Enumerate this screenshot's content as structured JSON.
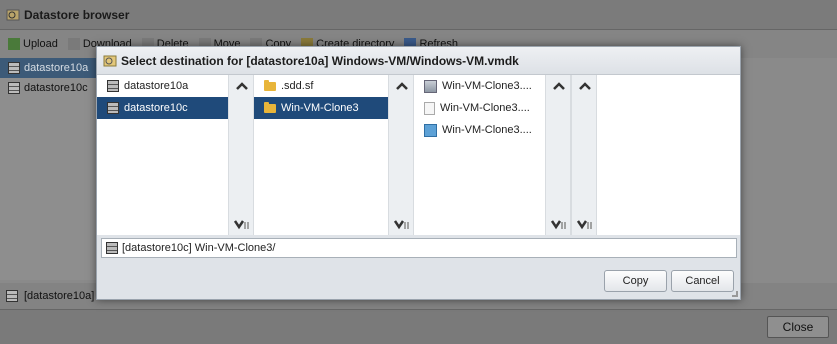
{
  "background": {
    "window_title": "Datastore browser",
    "toolbar": [
      "Upload",
      "Download",
      "Delete",
      "Move",
      "Copy",
      "Create directory",
      "Refresh"
    ],
    "datastores": [
      "datastore10a",
      "datastore10c"
    ],
    "status_path": "[datastore10a]",
    "close_label": "Close"
  },
  "dialog": {
    "title": "Select destination for [datastore10a] Windows-VM/Windows-VM.vmdk",
    "col1": [
      {
        "label": "datastore10a",
        "icon": "datastore-icon",
        "selected": false
      },
      {
        "label": "datastore10c",
        "icon": "datastore-icon",
        "selected": true
      }
    ],
    "col2": [
      {
        "label": ".sdd.sf",
        "icon": "folder-icon",
        "selected": false
      },
      {
        "label": "Win-VM-Clone3",
        "icon": "folder-icon",
        "selected": true
      }
    ],
    "col3": [
      {
        "label": "Win-VM-Clone3....",
        "icon": "disk-icon"
      },
      {
        "label": "Win-VM-Clone3....",
        "icon": "file-icon"
      },
      {
        "label": "Win-VM-Clone3....",
        "icon": "vm-icon"
      }
    ],
    "path": "[datastore10c] Win-VM-Clone3/",
    "copy_label": "Copy",
    "cancel_label": "Cancel"
  }
}
